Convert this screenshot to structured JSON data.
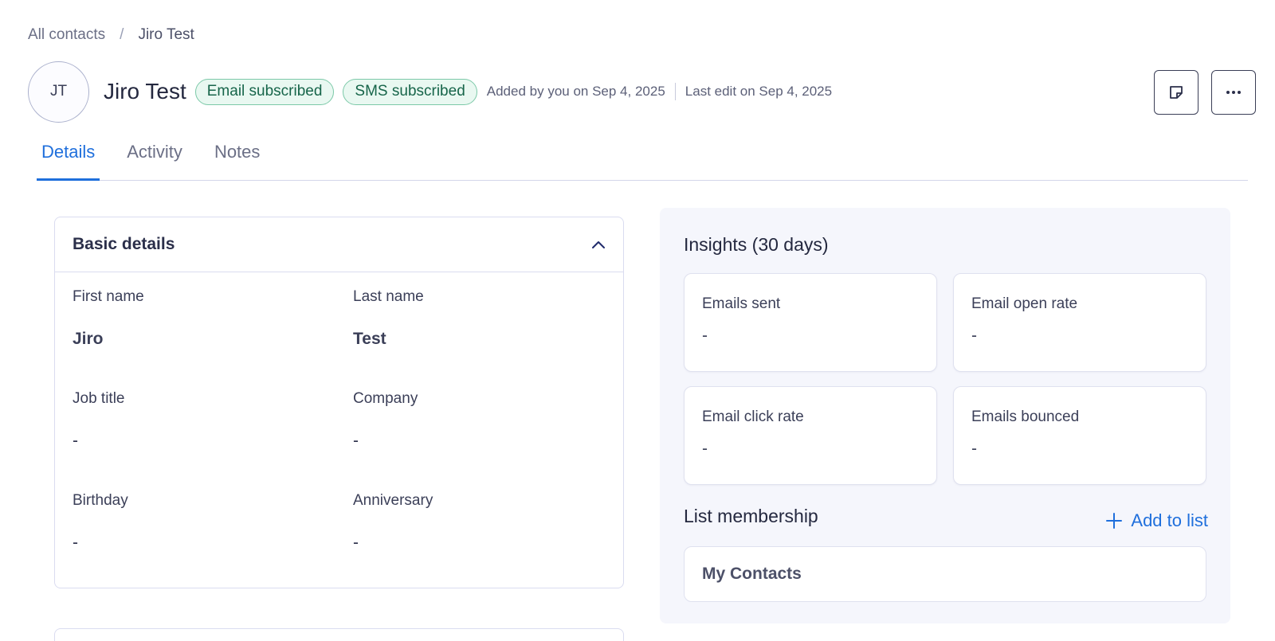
{
  "breadcrumb": {
    "parent": "All contacts",
    "separator": "/",
    "current": "Jiro Test"
  },
  "contact": {
    "initials": "JT",
    "name": "Jiro Test",
    "badges": [
      "Email subscribed",
      "SMS subscribed"
    ],
    "added": "Added by you on Sep 4, 2025",
    "last_edit": "Last edit on Sep 4, 2025"
  },
  "tabs": [
    {
      "label": "Details",
      "active": true
    },
    {
      "label": "Activity",
      "active": false
    },
    {
      "label": "Notes",
      "active": false
    }
  ],
  "basic_details": {
    "title": "Basic details",
    "fields": {
      "first_name": {
        "label": "First name",
        "value": "Jiro"
      },
      "last_name": {
        "label": "Last name",
        "value": "Test"
      },
      "job_title": {
        "label": "Job title",
        "value": "-"
      },
      "company": {
        "label": "Company",
        "value": "-"
      },
      "birthday": {
        "label": "Birthday",
        "value": "-"
      },
      "anniversary": {
        "label": "Anniversary",
        "value": "-"
      }
    }
  },
  "insights": {
    "title": "Insights (30 days)",
    "metrics": [
      {
        "label": "Emails sent",
        "value": "-"
      },
      {
        "label": "Email open rate",
        "value": "-"
      },
      {
        "label": "Email click rate",
        "value": "-"
      },
      {
        "label": "Emails bounced",
        "value": "-"
      }
    ]
  },
  "list_membership": {
    "title": "List membership",
    "add_label": "Add to list",
    "lists": [
      "My Contacts"
    ]
  },
  "colors": {
    "accent": "#1f6fdc",
    "badge_border": "#7cc9a8",
    "badge_bg": "#e9f8f1",
    "badge_text": "#17654a"
  }
}
